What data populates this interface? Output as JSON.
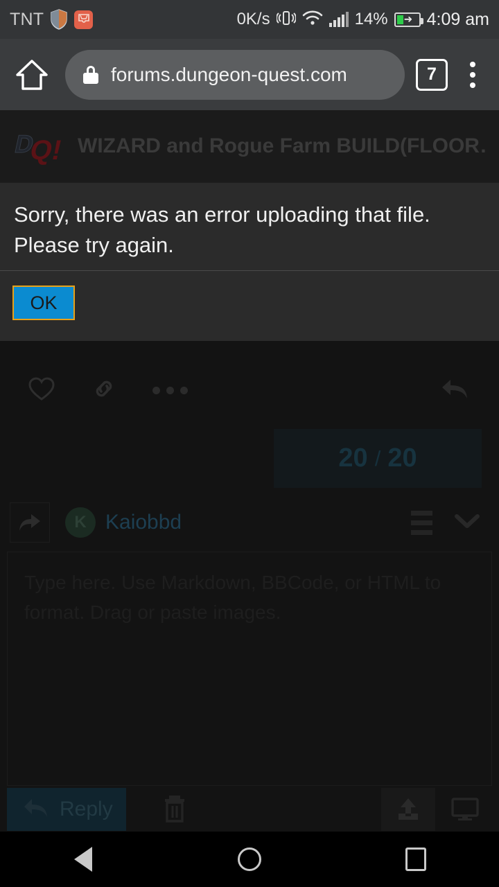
{
  "status_bar": {
    "carrier": "TNT",
    "shield_icon": "shield-icon",
    "app_icon": "inbox-app-icon",
    "network_speed": "0K/s",
    "vibrate_icon": "vibrate-icon",
    "wifi_icon": "wifi-icon",
    "signal_icon": "signal-bars-icon",
    "battery_percent": "14%",
    "battery_charging": true,
    "time": "4:09 am"
  },
  "browser": {
    "home_icon": "home-icon",
    "lock_icon": "lock-icon",
    "url": "forums.dungeon-quest.com",
    "tab_count": "7",
    "menu_icon": "overflow-menu-icon"
  },
  "site": {
    "logo_text": "DQ!",
    "topic_title": "WIZARD and Rogue Farm BUILD(FLOOR…"
  },
  "dialog": {
    "message": "Sorry, there was an error uploading that file. Please try again.",
    "ok_label": "OK",
    "button_fill": "#0b8bd0",
    "button_border": "#e9a117",
    "background": "#2b2b2b"
  },
  "post_actions": {
    "like_icon": "heart-icon",
    "link_icon": "link-icon",
    "more_icon": "ellipsis-icon",
    "reply_icon": "reply-arrow-icon"
  },
  "upload_progress": {
    "current": "20",
    "separator": "/",
    "total": "20"
  },
  "composer": {
    "forward_icon": "share-arrow-icon",
    "avatar_letter": "K",
    "username": "Kaiobbd",
    "list_icon": "hamburger-icon",
    "collapse_icon": "chevron-down-icon",
    "placeholder": "Type here. Use Markdown, BBCode, or HTML to format. Drag or paste images.",
    "reply_label": "Reply",
    "reply_icon": "reply-arrow-icon",
    "delete_icon": "trash-icon",
    "upload_icon": "upload-icon",
    "preview_icon": "monitor-icon"
  },
  "nav_bar": {
    "back_icon": "back-triangle-icon",
    "home_icon": "home-circle-icon",
    "recents_icon": "recents-square-icon"
  }
}
